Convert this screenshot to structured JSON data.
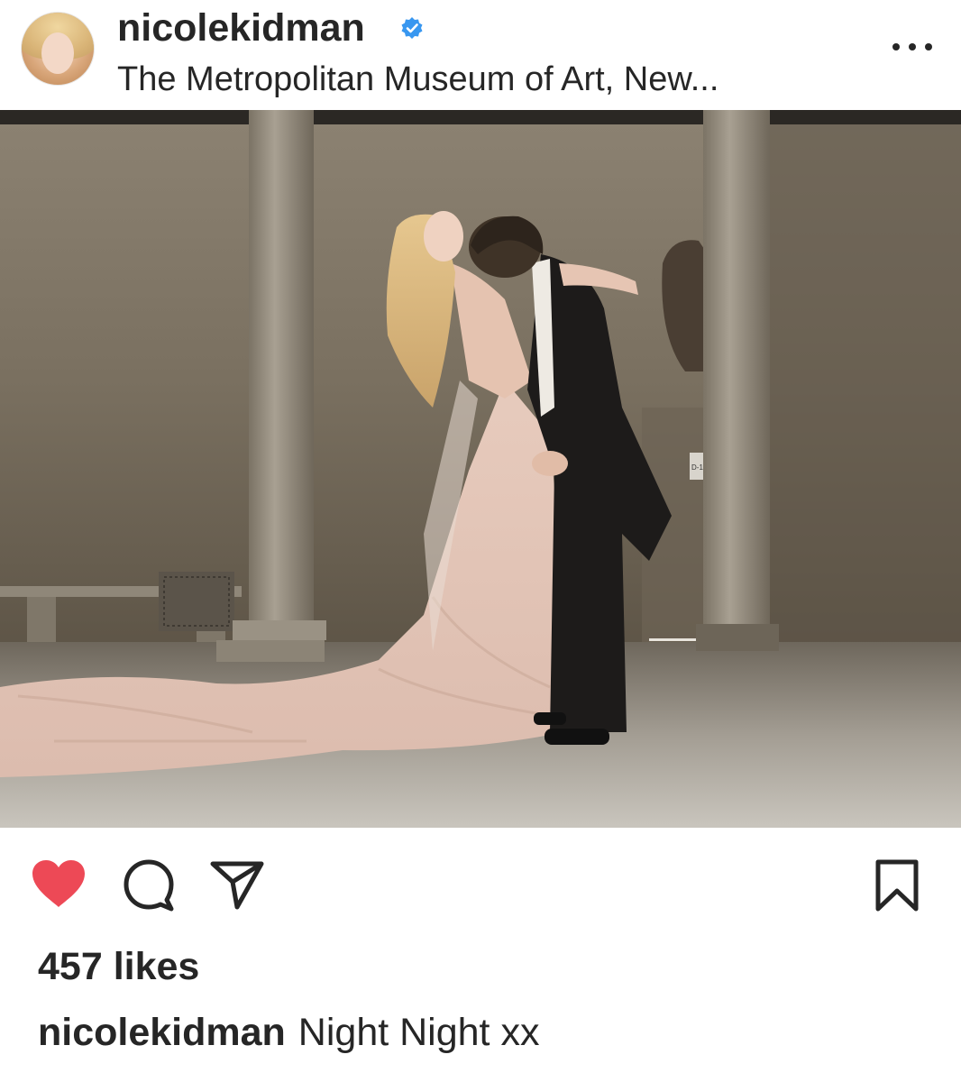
{
  "post": {
    "username": "nicolekidman",
    "verified": true,
    "location": "The Metropolitan Museum of Art, New...",
    "likes_text": "457 likes",
    "caption_user": "nicolekidman",
    "caption_text": "Night Night xx",
    "liked": true
  },
  "photo": {
    "sign_text": "D-1"
  },
  "colors": {
    "like_red": "#ed4956",
    "verified_blue": "#3897f0",
    "text": "#262626"
  },
  "icons": {
    "more": "more-options-icon",
    "like": "heart-filled-icon",
    "comment": "comment-bubble-icon",
    "share": "paper-plane-icon",
    "save": "bookmark-icon",
    "verified": "verified-badge-icon"
  }
}
